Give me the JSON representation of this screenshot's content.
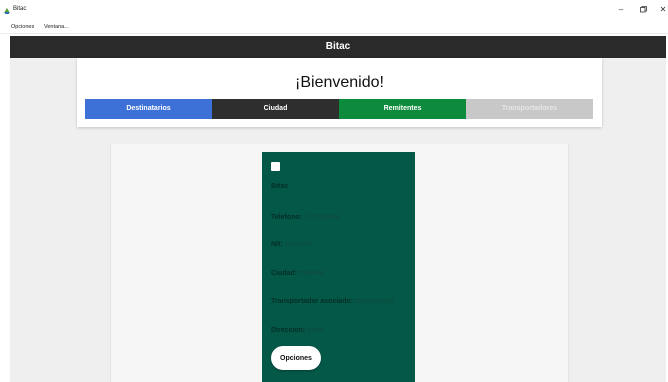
{
  "window": {
    "title": "Bitac",
    "minimize_glyph": "–",
    "close_glyph": "✕"
  },
  "menubar": {
    "items": [
      {
        "label": "Opciones"
      },
      {
        "label": "Ventana..."
      }
    ]
  },
  "app": {
    "header_title": "Bitac",
    "welcome": "¡Bienvenido!",
    "nav": [
      {
        "label": "Destinatarios",
        "color": "#3d71d8"
      },
      {
        "label": "Ciudad",
        "color": "#2e2e2e"
      },
      {
        "label": "Remitentes",
        "color": "#0d8a3b"
      },
      {
        "label": "Transportadores",
        "color": "#c8c8c8"
      }
    ]
  },
  "card": {
    "name": "Bitac",
    "telefono_label": "Telefono:",
    "telefono": "310265489",
    "nit_label": "Nit:",
    "nit": "1044050",
    "ciudad_label": "Ciudad:",
    "ciudad": "medellin",
    "transportador_label": "Transportador asociado:",
    "transportador": "servientrega",
    "direccion_label": "Direccion:",
    "direccion": "####",
    "button_label": "Opciones",
    "background": "#045848"
  }
}
